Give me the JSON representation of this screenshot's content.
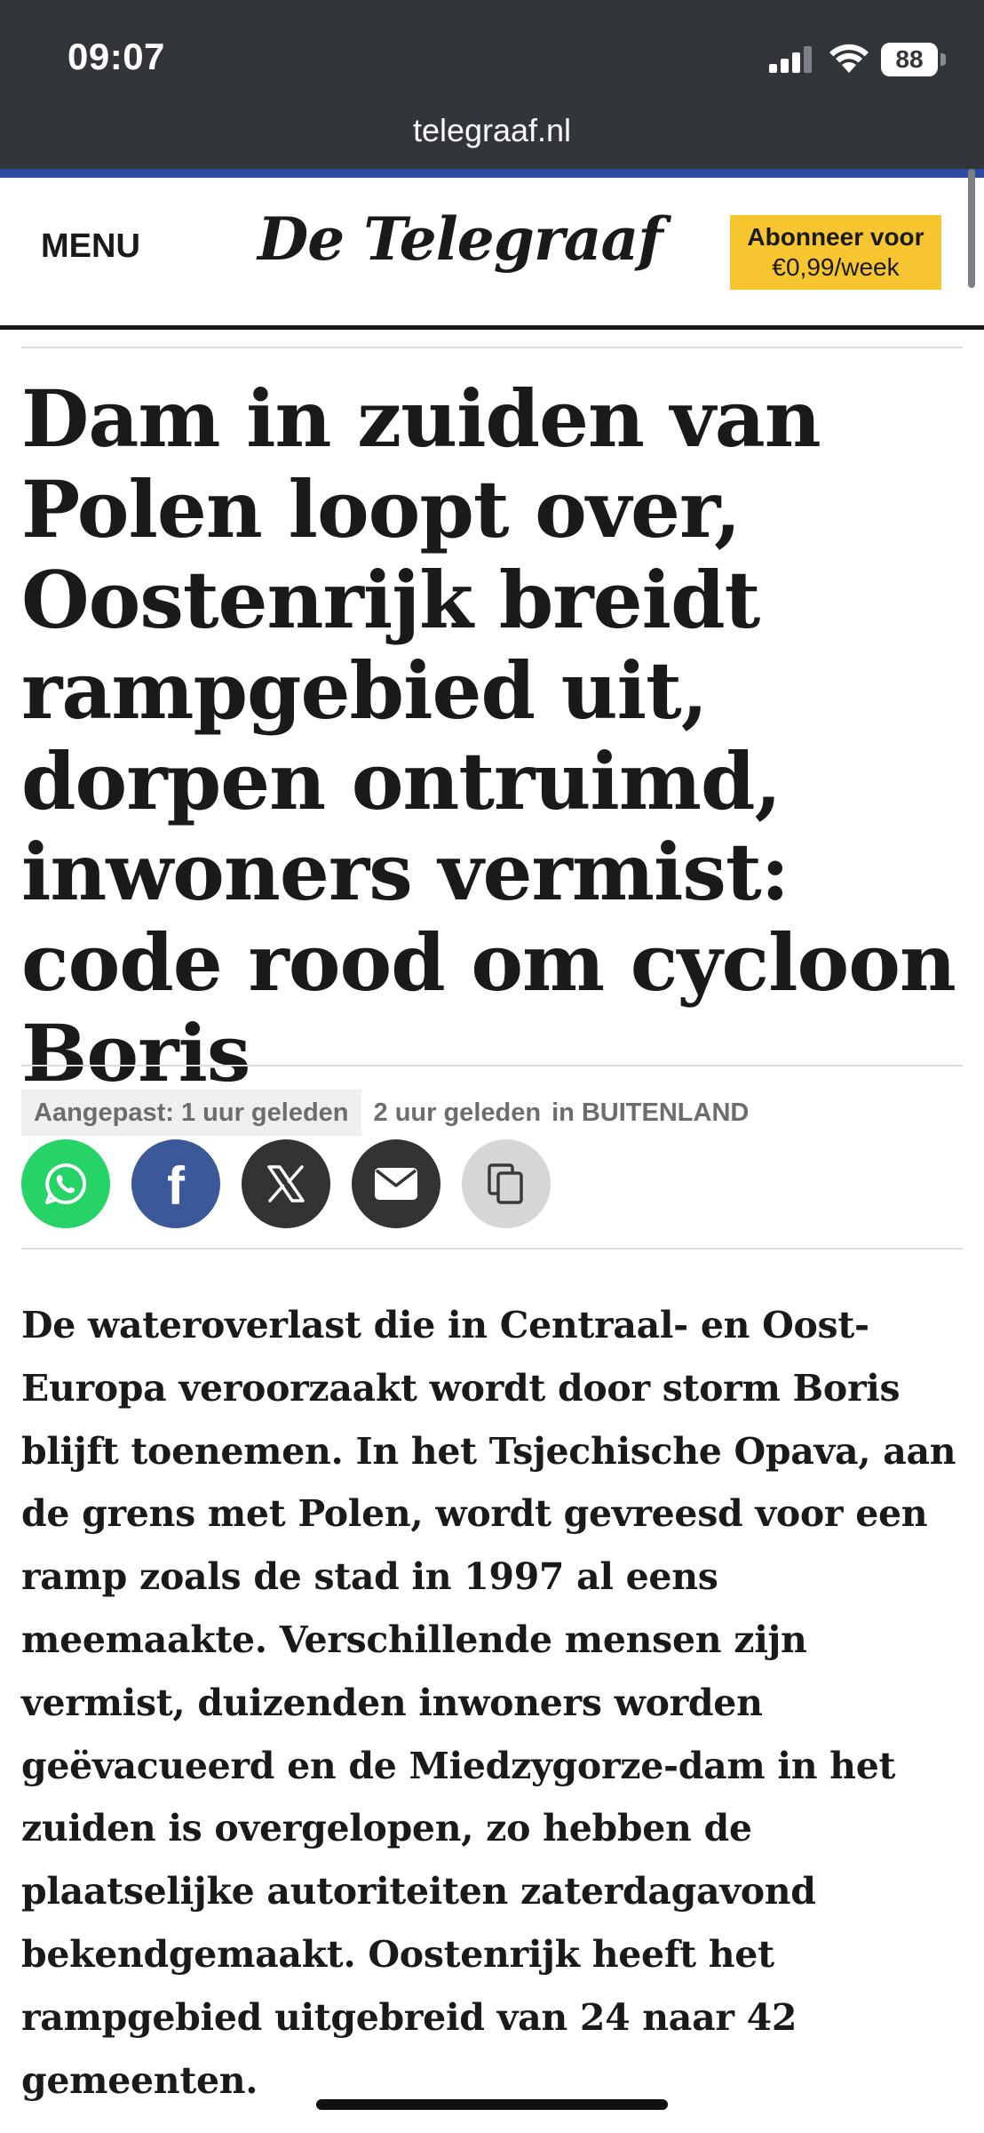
{
  "status_bar": {
    "time": "09:07",
    "battery": "88",
    "icons": [
      "signal-icon",
      "wifi-icon",
      "battery-icon"
    ]
  },
  "browser": {
    "url": "telegraaf.nl"
  },
  "site_header": {
    "menu_label": "MENU",
    "logo": "De Telegraaf",
    "subscribe_line1": "Abonneer voor",
    "subscribe_line2": "€0,99/week",
    "colors": {
      "subscribe_bg": "#f7c52f",
      "brand_strip": "#2b4aa0"
    }
  },
  "article": {
    "headline": "Dam in zuiden van Polen loopt over, Oostenrijk breidt rampgebied uit, dorpen ontruimd, inwoners vermist: code rood om cycloon Boris",
    "meta": {
      "updated": "Aangepast: 1 uur geleden",
      "published": "2 uur geleden",
      "section_prefix": "in",
      "section": "BUITENLAND"
    },
    "share": [
      {
        "name": "whatsapp",
        "icon": "whatsapp-icon",
        "color": "#25d366"
      },
      {
        "name": "facebook",
        "icon": "facebook-icon",
        "color": "#3b5998"
      },
      {
        "name": "x",
        "icon": "x-icon",
        "color": "#333333"
      },
      {
        "name": "email",
        "icon": "mail-icon",
        "color": "#333333"
      },
      {
        "name": "copy",
        "icon": "copy-icon",
        "color": "#d4d6d8"
      }
    ],
    "intro": "De wateroverlast die in Centraal- en Oost-Europa veroorzaakt wordt door storm Boris blijft toenemen. In het Tsjechische Opava, aan de grens met Polen, wordt gevreesd voor een ramp zoals de stad in 1997 al eens meemaakte. Verschillende mensen zijn vermist, duizenden inwoners worden geëvacueerd en de Miedzygorze-dam in het zuiden is overgelopen, zo hebben de plaatselijke autoriteiten zaterdagavond bekendgemaakt. Oostenrijk heeft het rampgebied uitgebreid van 24 naar 42 gemeenten."
  }
}
